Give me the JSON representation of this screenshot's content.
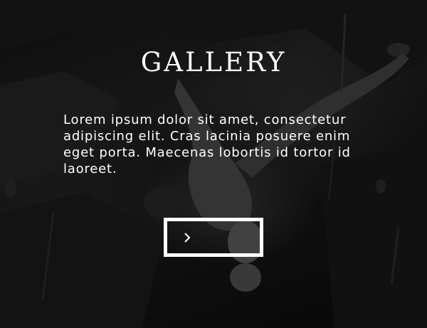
{
  "hero": {
    "title": "GALLERY",
    "description": "Lorem ipsum dolor sit amet, consectetur adipiscing elit. Cras lacinia posuere enim eget porta. Maecenas lobortis id tortor id laoreet.",
    "background_image": "climber-photo",
    "next_button_icon": "chevron-right-icon"
  },
  "colors": {
    "text": "#ffffff",
    "button_border": "#ffffff",
    "overlay": "#000000"
  }
}
